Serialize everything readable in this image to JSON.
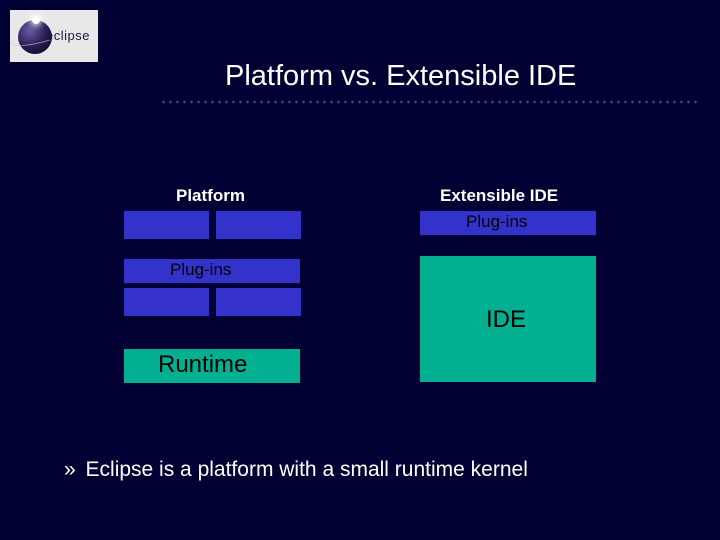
{
  "logo_text": "eclipse",
  "title": "Platform vs. Extensible IDE",
  "columns": {
    "left_header": "Platform",
    "right_header": "Extensible IDE"
  },
  "labels": {
    "plugins_left": "Plug-ins",
    "plugins_right": "Plug-ins",
    "runtime": "Runtime",
    "ide": "IDE"
  },
  "footer": {
    "bullet": "»",
    "text": "Eclipse is a platform with a small runtime kernel"
  }
}
